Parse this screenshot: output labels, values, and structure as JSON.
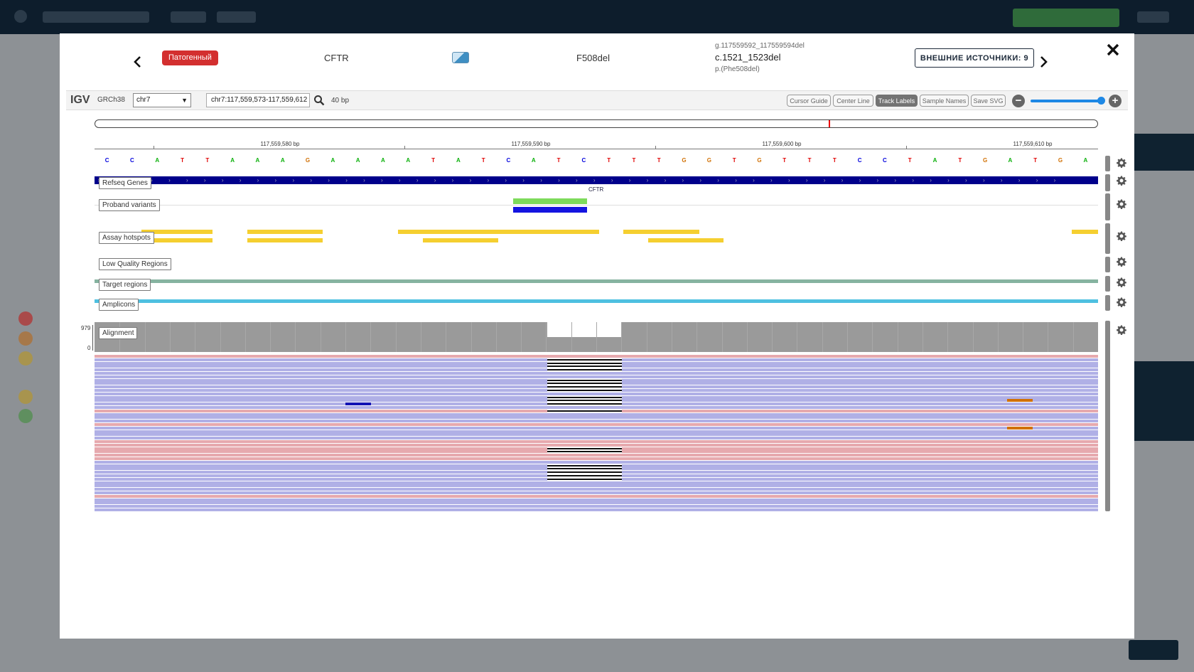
{
  "modal": {
    "classification_badge": "Патогенный",
    "gene": "CFTR",
    "variant_name": "F508del",
    "hgvs_g": "g.117559592_117559594del",
    "hgvs_c": "c.1521_1523del",
    "hgvs_p": "p.(Phe508del)",
    "external_sources_button": "ВНЕШНИЕ ИСТОЧНИКИ: 9",
    "close_glyph": "✕",
    "prev_glyph": "‹",
    "next_glyph": "›"
  },
  "igv": {
    "logo": "IGV",
    "genome": "GRCh38",
    "chromosome": "chr7",
    "locus": "chr7:117,559,573-117,559,612",
    "window_size": "40 bp",
    "buttons": {
      "cursor_guide": "Cursor Guide",
      "center_line": "Center Line",
      "track_labels": "Track Labels",
      "sample_names": "Sample Names",
      "save_svg": "Save SVG"
    },
    "zoom_level": 0.97,
    "ruler_labels": [
      "117,559,580 bp",
      "117,559,590 bp",
      "117,559,600 bp",
      "117,559,610 bp"
    ],
    "sequence": [
      "C",
      "C",
      "A",
      "T",
      "T",
      "A",
      "A",
      "A",
      "G",
      "A",
      "A",
      "A",
      "A",
      "T",
      "A",
      "T",
      "C",
      "A",
      "T",
      "C",
      "T",
      "T",
      "T",
      "G",
      "G",
      "T",
      "G",
      "T",
      "T",
      "T",
      "C",
      "C",
      "T",
      "A",
      "T",
      "G",
      "A",
      "T",
      "G",
      "A"
    ],
    "base_colors": {
      "A": "#0bb00b",
      "C": "#0000dd",
      "G": "#d17105",
      "T": "#e00000"
    },
    "tracks": {
      "refseq": "Refseq Genes",
      "refseq_gene": "CFTR",
      "proband": "Proband variants",
      "hotspots": "Assay hotspots",
      "low_quality": "Low Quality Regions",
      "target": "Target regions",
      "amplicons": "Amplicons",
      "alignment": "Alignment"
    },
    "coverage_max": "979",
    "coverage_min": "0",
    "colors": {
      "gene": "#00008b",
      "proband_green": "#7ddb5b",
      "proband_blue": "#1414e0",
      "hotspot": "#f5cf30",
      "target": "#86b3a0",
      "amplicon": "#4ec0e0",
      "read_forward": "#b0b0e6",
      "read_reverse": "#e6a9ae"
    }
  }
}
